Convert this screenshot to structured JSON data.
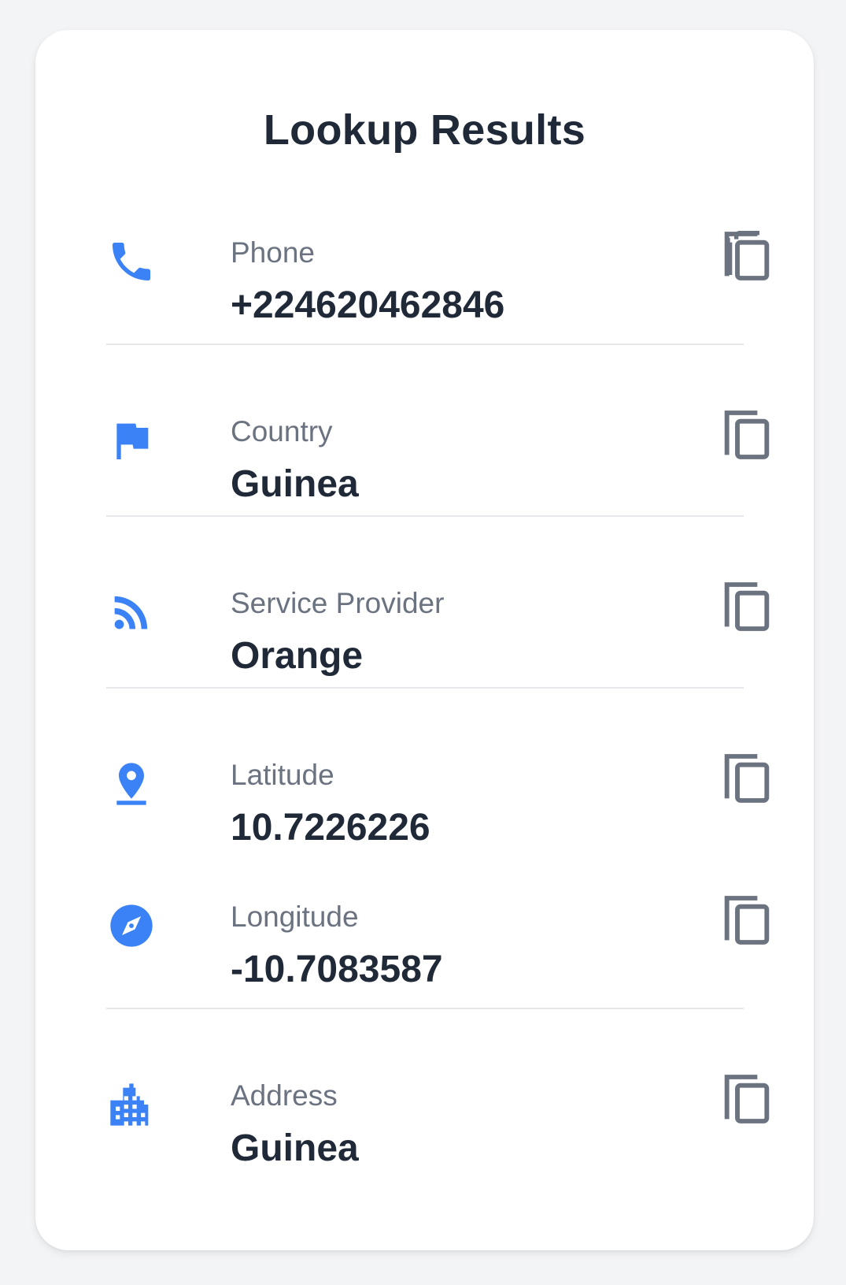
{
  "card": {
    "title": "Lookup Results"
  },
  "colors": {
    "accent": "#3b82f6",
    "icon_gray": "#6b7280",
    "text_dark": "#1f2937",
    "text_muted": "#6b7280",
    "divider": "#e5e7eb",
    "background": "#f3f4f6"
  },
  "results": [
    {
      "icon": "phone-icon",
      "label": "Phone",
      "value": "+224620462846"
    },
    {
      "icon": "flag-icon",
      "label": "Country",
      "value": "Guinea"
    },
    {
      "icon": "rss-icon",
      "label": "Service Provider",
      "value": "Orange"
    },
    {
      "icon": "location-pin-icon",
      "label": "Latitude",
      "value": "10.7226226"
    },
    {
      "icon": "compass-icon",
      "label": "Longitude",
      "value": "-10.7083587"
    },
    {
      "icon": "building-icon",
      "label": "Address",
      "value": "Guinea"
    }
  ]
}
